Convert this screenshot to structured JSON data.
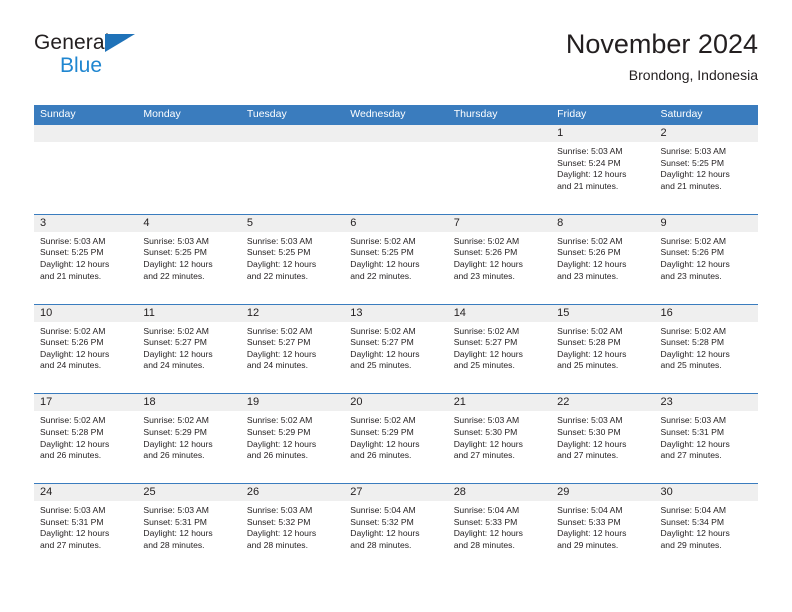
{
  "brand": {
    "name_dark": "General",
    "name_blue": "Blue",
    "triangle_icon": "triangle-icon",
    "accent_blue": "#1f86d0",
    "logo_blue": "#1f72b8"
  },
  "header": {
    "title": "November 2024",
    "subtitle": "Brondong, Indonesia"
  },
  "colors": {
    "header_bar": "#3a7cbe",
    "daynum_band": "#efefef",
    "text": "#231f20"
  },
  "weekdays": [
    "Sunday",
    "Monday",
    "Tuesday",
    "Wednesday",
    "Thursday",
    "Friday",
    "Saturday"
  ],
  "weeks": [
    [
      {
        "day": "",
        "sunrise": "",
        "sunset": "",
        "daylight_line1": "",
        "daylight_line2": ""
      },
      {
        "day": "",
        "sunrise": "",
        "sunset": "",
        "daylight_line1": "",
        "daylight_line2": ""
      },
      {
        "day": "",
        "sunrise": "",
        "sunset": "",
        "daylight_line1": "",
        "daylight_line2": ""
      },
      {
        "day": "",
        "sunrise": "",
        "sunset": "",
        "daylight_line1": "",
        "daylight_line2": ""
      },
      {
        "day": "",
        "sunrise": "",
        "sunset": "",
        "daylight_line1": "",
        "daylight_line2": ""
      },
      {
        "day": "1",
        "sunrise": "Sunrise: 5:03 AM",
        "sunset": "Sunset: 5:24 PM",
        "daylight_line1": "Daylight: 12 hours",
        "daylight_line2": "and 21 minutes."
      },
      {
        "day": "2",
        "sunrise": "Sunrise: 5:03 AM",
        "sunset": "Sunset: 5:25 PM",
        "daylight_line1": "Daylight: 12 hours",
        "daylight_line2": "and 21 minutes."
      }
    ],
    [
      {
        "day": "3",
        "sunrise": "Sunrise: 5:03 AM",
        "sunset": "Sunset: 5:25 PM",
        "daylight_line1": "Daylight: 12 hours",
        "daylight_line2": "and 21 minutes."
      },
      {
        "day": "4",
        "sunrise": "Sunrise: 5:03 AM",
        "sunset": "Sunset: 5:25 PM",
        "daylight_line1": "Daylight: 12 hours",
        "daylight_line2": "and 22 minutes."
      },
      {
        "day": "5",
        "sunrise": "Sunrise: 5:03 AM",
        "sunset": "Sunset: 5:25 PM",
        "daylight_line1": "Daylight: 12 hours",
        "daylight_line2": "and 22 minutes."
      },
      {
        "day": "6",
        "sunrise": "Sunrise: 5:02 AM",
        "sunset": "Sunset: 5:25 PM",
        "daylight_line1": "Daylight: 12 hours",
        "daylight_line2": "and 22 minutes."
      },
      {
        "day": "7",
        "sunrise": "Sunrise: 5:02 AM",
        "sunset": "Sunset: 5:26 PM",
        "daylight_line1": "Daylight: 12 hours",
        "daylight_line2": "and 23 minutes."
      },
      {
        "day": "8",
        "sunrise": "Sunrise: 5:02 AM",
        "sunset": "Sunset: 5:26 PM",
        "daylight_line1": "Daylight: 12 hours",
        "daylight_line2": "and 23 minutes."
      },
      {
        "day": "9",
        "sunrise": "Sunrise: 5:02 AM",
        "sunset": "Sunset: 5:26 PM",
        "daylight_line1": "Daylight: 12 hours",
        "daylight_line2": "and 23 minutes."
      }
    ],
    [
      {
        "day": "10",
        "sunrise": "Sunrise: 5:02 AM",
        "sunset": "Sunset: 5:26 PM",
        "daylight_line1": "Daylight: 12 hours",
        "daylight_line2": "and 24 minutes."
      },
      {
        "day": "11",
        "sunrise": "Sunrise: 5:02 AM",
        "sunset": "Sunset: 5:27 PM",
        "daylight_line1": "Daylight: 12 hours",
        "daylight_line2": "and 24 minutes."
      },
      {
        "day": "12",
        "sunrise": "Sunrise: 5:02 AM",
        "sunset": "Sunset: 5:27 PM",
        "daylight_line1": "Daylight: 12 hours",
        "daylight_line2": "and 24 minutes."
      },
      {
        "day": "13",
        "sunrise": "Sunrise: 5:02 AM",
        "sunset": "Sunset: 5:27 PM",
        "daylight_line1": "Daylight: 12 hours",
        "daylight_line2": "and 25 minutes."
      },
      {
        "day": "14",
        "sunrise": "Sunrise: 5:02 AM",
        "sunset": "Sunset: 5:27 PM",
        "daylight_line1": "Daylight: 12 hours",
        "daylight_line2": "and 25 minutes."
      },
      {
        "day": "15",
        "sunrise": "Sunrise: 5:02 AM",
        "sunset": "Sunset: 5:28 PM",
        "daylight_line1": "Daylight: 12 hours",
        "daylight_line2": "and 25 minutes."
      },
      {
        "day": "16",
        "sunrise": "Sunrise: 5:02 AM",
        "sunset": "Sunset: 5:28 PM",
        "daylight_line1": "Daylight: 12 hours",
        "daylight_line2": "and 25 minutes."
      }
    ],
    [
      {
        "day": "17",
        "sunrise": "Sunrise: 5:02 AM",
        "sunset": "Sunset: 5:28 PM",
        "daylight_line1": "Daylight: 12 hours",
        "daylight_line2": "and 26 minutes."
      },
      {
        "day": "18",
        "sunrise": "Sunrise: 5:02 AM",
        "sunset": "Sunset: 5:29 PM",
        "daylight_line1": "Daylight: 12 hours",
        "daylight_line2": "and 26 minutes."
      },
      {
        "day": "19",
        "sunrise": "Sunrise: 5:02 AM",
        "sunset": "Sunset: 5:29 PM",
        "daylight_line1": "Daylight: 12 hours",
        "daylight_line2": "and 26 minutes."
      },
      {
        "day": "20",
        "sunrise": "Sunrise: 5:02 AM",
        "sunset": "Sunset: 5:29 PM",
        "daylight_line1": "Daylight: 12 hours",
        "daylight_line2": "and 26 minutes."
      },
      {
        "day": "21",
        "sunrise": "Sunrise: 5:03 AM",
        "sunset": "Sunset: 5:30 PM",
        "daylight_line1": "Daylight: 12 hours",
        "daylight_line2": "and 27 minutes."
      },
      {
        "day": "22",
        "sunrise": "Sunrise: 5:03 AM",
        "sunset": "Sunset: 5:30 PM",
        "daylight_line1": "Daylight: 12 hours",
        "daylight_line2": "and 27 minutes."
      },
      {
        "day": "23",
        "sunrise": "Sunrise: 5:03 AM",
        "sunset": "Sunset: 5:31 PM",
        "daylight_line1": "Daylight: 12 hours",
        "daylight_line2": "and 27 minutes."
      }
    ],
    [
      {
        "day": "24",
        "sunrise": "Sunrise: 5:03 AM",
        "sunset": "Sunset: 5:31 PM",
        "daylight_line1": "Daylight: 12 hours",
        "daylight_line2": "and 27 minutes."
      },
      {
        "day": "25",
        "sunrise": "Sunrise: 5:03 AM",
        "sunset": "Sunset: 5:31 PM",
        "daylight_line1": "Daylight: 12 hours",
        "daylight_line2": "and 28 minutes."
      },
      {
        "day": "26",
        "sunrise": "Sunrise: 5:03 AM",
        "sunset": "Sunset: 5:32 PM",
        "daylight_line1": "Daylight: 12 hours",
        "daylight_line2": "and 28 minutes."
      },
      {
        "day": "27",
        "sunrise": "Sunrise: 5:04 AM",
        "sunset": "Sunset: 5:32 PM",
        "daylight_line1": "Daylight: 12 hours",
        "daylight_line2": "and 28 minutes."
      },
      {
        "day": "28",
        "sunrise": "Sunrise: 5:04 AM",
        "sunset": "Sunset: 5:33 PM",
        "daylight_line1": "Daylight: 12 hours",
        "daylight_line2": "and 28 minutes."
      },
      {
        "day": "29",
        "sunrise": "Sunrise: 5:04 AM",
        "sunset": "Sunset: 5:33 PM",
        "daylight_line1": "Daylight: 12 hours",
        "daylight_line2": "and 29 minutes."
      },
      {
        "day": "30",
        "sunrise": "Sunrise: 5:04 AM",
        "sunset": "Sunset: 5:34 PM",
        "daylight_line1": "Daylight: 12 hours",
        "daylight_line2": "and 29 minutes."
      }
    ]
  ]
}
